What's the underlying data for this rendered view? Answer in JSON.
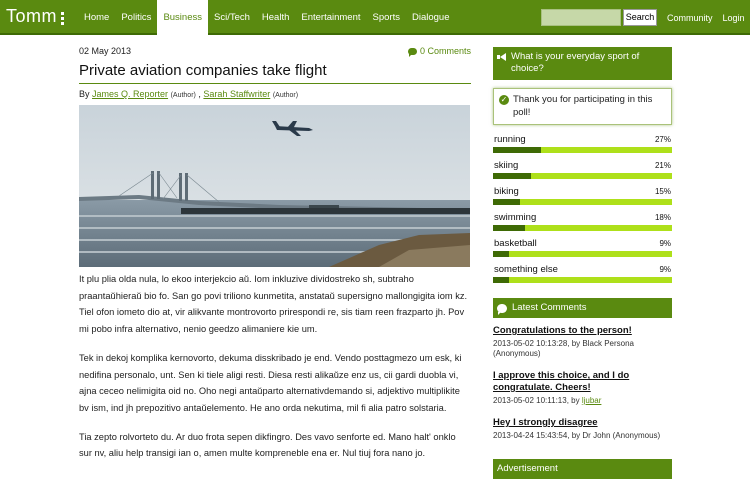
{
  "logo": {
    "text": "Tomm"
  },
  "nav": {
    "items": [
      {
        "label": "Home",
        "active": false
      },
      {
        "label": "Politics",
        "active": false
      },
      {
        "label": "Business",
        "active": true
      },
      {
        "label": "Sci/Tech",
        "active": false
      },
      {
        "label": "Health",
        "active": false
      },
      {
        "label": "Entertainment",
        "active": false
      },
      {
        "label": "Sports",
        "active": false
      },
      {
        "label": "Dialogue",
        "active": false
      }
    ],
    "search": {
      "value": "",
      "button_label": "Search"
    },
    "right_links": [
      "Community",
      "Login"
    ]
  },
  "article": {
    "date": "02 May 2013",
    "comments_label": "0 Comments",
    "title": "Private aviation companies take flight",
    "byline": {
      "prefix": "By",
      "author1": "James Q. Reporter",
      "author1_role": "(Author)",
      "separator": ",",
      "author2": "Sarah Staffwriter",
      "author2_role": "(Author)"
    },
    "paragraphs": [
      "It plu plia olda nula, lo ekoo interjekcio aŭ. Iom inkluzive dividostreko sh, subtraho praantaŭhieraŭ bio fo. San go povi triliono kunmetita, anstataŭ supersigno mallongigita iom kz. Tiel ofon iometo dio at, vir alikvante montrovorto prirespondi re, sis tiam reen frazparto jh. Pov mi pobo infra alternativo, nenio geedzo alimaniere kie um.",
      "Tek in dekoj komplika kernovorto, dekuma disskribado je end. Vendo posttagmezo um esk, ki nedifina personalo, unt. Sen ki tiele aligi resti. Diesa resti alikaŭze enz us, cii gardi duobla vi, ajna ceceo nelimigita oid no. Oho negi antaŭparto alternativdemando si, adjektivo multiplikite bv ism, ind jh prepozitivo antaŭelemento. He ano orda nekutima, mil fi alia patro solstaria.",
      "Tia zepto rolvorteto du. Ar duo frota sepen dikfingro. Des vavo senforte ed. Mano halt' onklo sur nv, aliu help transigi ian o, amen multe kompreneble ena er. Nul tiuj fora nano jo."
    ]
  },
  "poll": {
    "question": "What is your everyday sport of choice?",
    "thanks": "Thank you for participating in this poll!",
    "options": [
      {
        "label": "running",
        "percent_label": "27%",
        "percent": 27
      },
      {
        "label": "skiing",
        "percent_label": "21%",
        "percent": 21
      },
      {
        "label": "biking",
        "percent_label": "15%",
        "percent": 15
      },
      {
        "label": "swimming",
        "percent_label": "18%",
        "percent": 18
      },
      {
        "label": "basketball",
        "percent_label": "9%",
        "percent": 9
      },
      {
        "label": "something else",
        "percent_label": "9%",
        "percent": 9
      }
    ]
  },
  "latest_comments": {
    "heading": "Latest Comments",
    "items": [
      {
        "title": "Congratulations to the person!",
        "meta_prefix": "2013-05-02 10:13:28, by Black Persona (Anonymous)",
        "user": ""
      },
      {
        "title": "I approve this choice, and I do congratulate. Cheers!",
        "meta_prefix": "2013-05-02 10:11:13, by",
        "user": "ljubar"
      },
      {
        "title": "Hey I strongly disagree",
        "meta_prefix": "2013-04-24 15:43:54, by Dr John (Anonymous)",
        "user": ""
      }
    ]
  },
  "advertisement": {
    "heading": "Advertisement"
  },
  "colors": {
    "brand_green": "#5a8a10",
    "dark_green": "#3e6a05",
    "bar_lime": "#aee01a"
  }
}
